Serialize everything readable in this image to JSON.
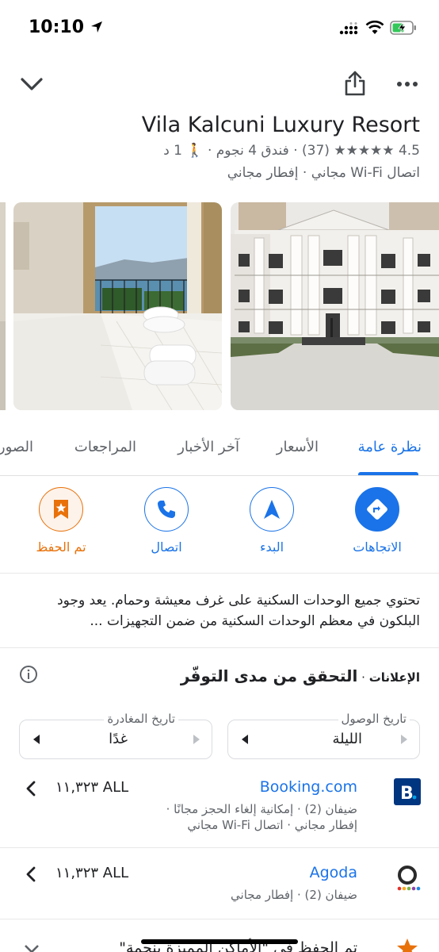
{
  "status": {
    "time": "10:10"
  },
  "place": {
    "name": "Vila Kalcuni Luxury Resort",
    "meta_line1": "4.5 ★★★★★ (37) · فندق 4 نجوم · 🚶 1 د",
    "meta_line2": "اتصال Wi-Fi مجاني · إفطار مجاني"
  },
  "tabs": [
    "نظرة عامة",
    "الأسعار",
    "آخر الأخبار",
    "المراجعات",
    "الصور"
  ],
  "actions": {
    "directions": "الاتجاهات",
    "start": "البدء",
    "call": "اتصال",
    "saved": "تم الحفظ"
  },
  "description": "تحتوي جميع الوحدات السكنية على غرف معيشة وحمام. يعد وجود البلكون في معظم الوحدات السكنية من ضمن التجهيزات ...",
  "ads": {
    "prefix": "الإعلانات",
    "title": "التحقق من مدى التوفّر"
  },
  "dates": {
    "checkin_label": "تاريخ الوصول",
    "checkin_value": "الليلة",
    "checkout_label": "تاريخ المغادرة",
    "checkout_value": "غدًا"
  },
  "offers": [
    {
      "provider": "Booking.com",
      "price": "١١,٣٢٣ ALL",
      "line1": "ضيفان (2) · إمكانية إلغاء الحجز مجانًا ·",
      "line2": "إفطار مجاني · اتصال Wi-Fi مجاني"
    },
    {
      "provider": "Agoda",
      "price": "١١,٣٢٣ ALL",
      "line1": "ضيفان (2) · إفطار مجاني",
      "line2": ""
    }
  ],
  "footer_partial": "تم الحفظ في \"الأماكن المميزة بنجمة\"",
  "colors": {
    "accent": "#1a73e8",
    "saved": "#e8710a",
    "star": "#fbbc04"
  }
}
